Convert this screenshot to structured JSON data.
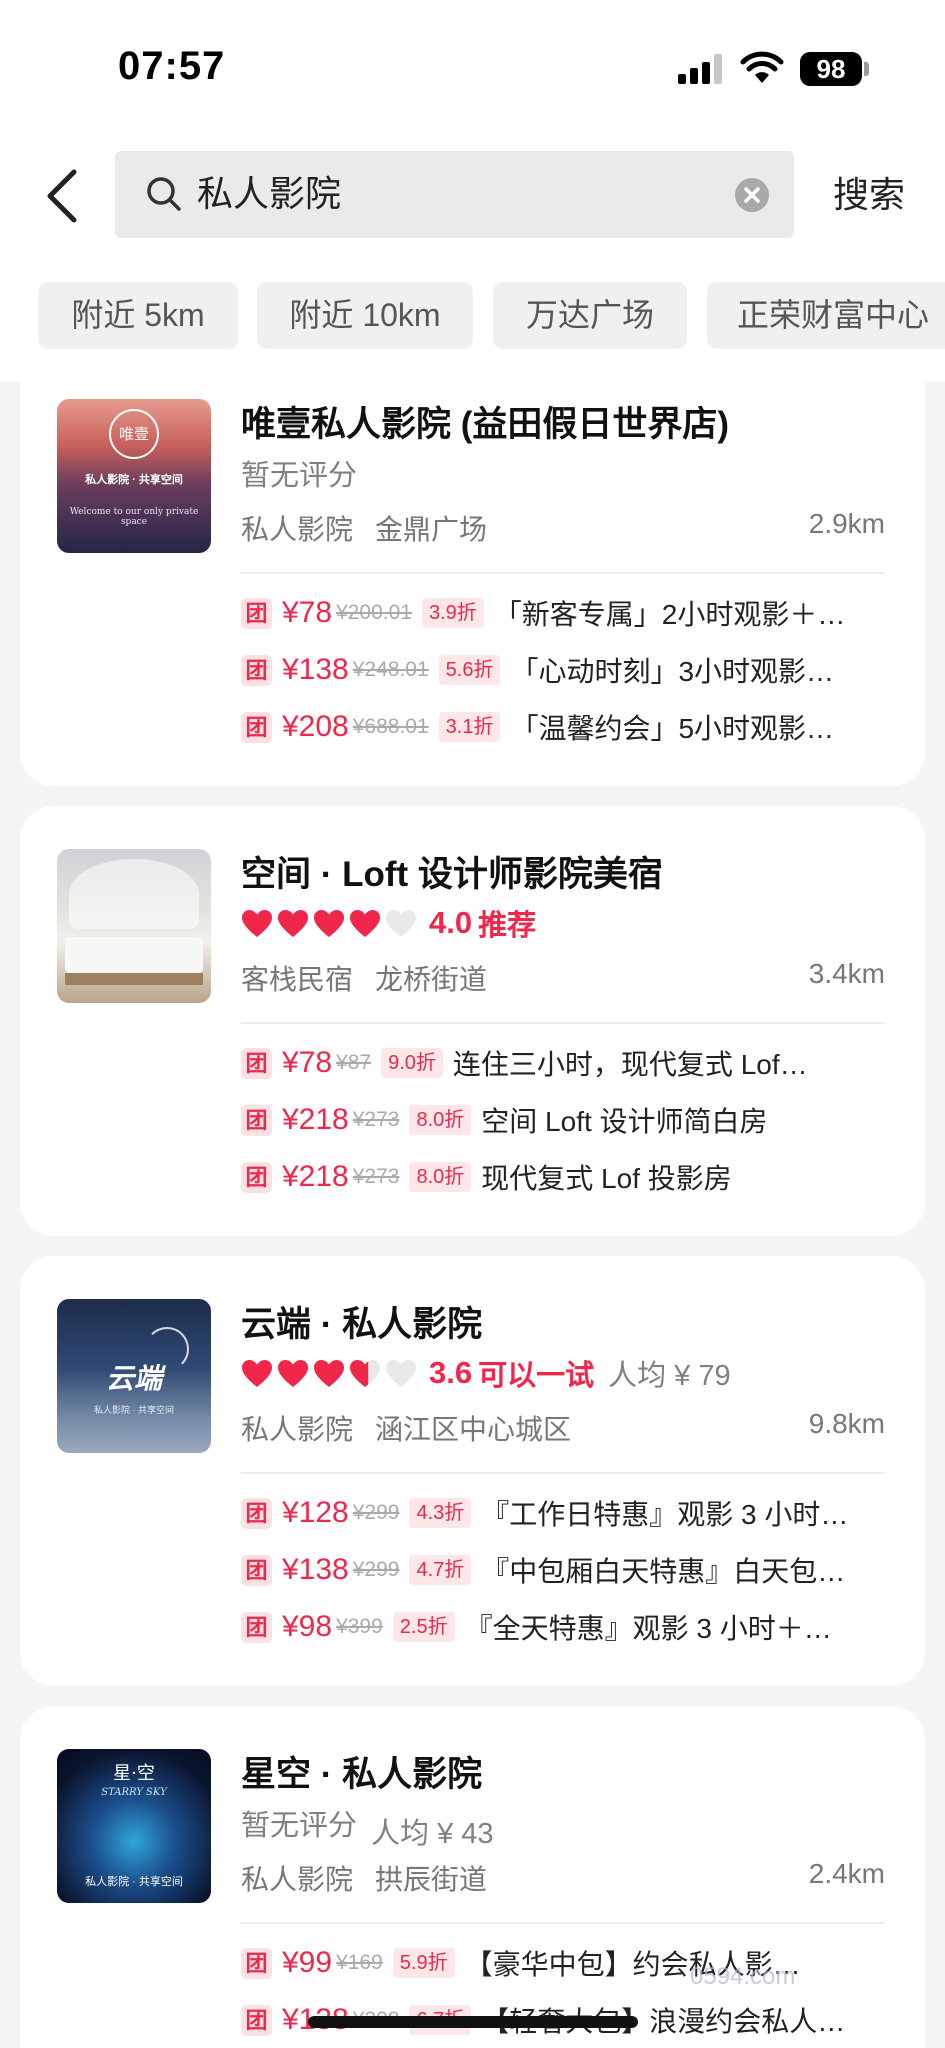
{
  "status": {
    "time": "07:57",
    "battery": "98"
  },
  "search": {
    "query": "私人影院",
    "button": "搜索"
  },
  "chips": [
    "附近 5km",
    "附近 10km",
    "万达广场",
    "正荣财富中心"
  ],
  "listings": [
    {
      "name": "唯壹私人影院 (益田假日世界店)",
      "rating_text": "暂无评分",
      "category": "私人影院",
      "area": "金鼎广场",
      "distance": "2.9km",
      "thumb_text": "私人影院 · 共享空间",
      "thumb_sub": "Welcome to our only private space",
      "thumb_logo": "唯壹",
      "deals": [
        {
          "tag": "团",
          "price": "¥78",
          "original": "¥200.01",
          "discount": "3.9折",
          "title": "「新客专属」2小时观影＋…"
        },
        {
          "tag": "团",
          "price": "¥138",
          "original": "¥248.01",
          "discount": "5.6折",
          "title": "「心动时刻」3小时观影…"
        },
        {
          "tag": "团",
          "price": "¥208",
          "original": "¥688.01",
          "discount": "3.1折",
          "title": "「温馨约会」5小时观影…"
        }
      ]
    },
    {
      "name": "空间 · Loft 设计师影院美宿",
      "score": "4.0",
      "hearts_value": 4.0,
      "verdict": "推荐",
      "category": "客栈民宿",
      "area": "龙桥街道",
      "distance": "3.4km",
      "deals": [
        {
          "tag": "团",
          "price": "¥78",
          "original": "¥87",
          "discount": "9.0折",
          "title": "连住三小时，现代复式 Lof…"
        },
        {
          "tag": "团",
          "price": "¥218",
          "original": "¥273",
          "discount": "8.0折",
          "title": "空间 Loft 设计师简白房"
        },
        {
          "tag": "团",
          "price": "¥218",
          "original": "¥273",
          "discount": "8.0折",
          "title": "现代复式 Lof 投影房"
        }
      ]
    },
    {
      "name": "云端 · 私人影院",
      "score": "3.6",
      "hearts_value": 3.6,
      "verdict": "可以一试",
      "avg_price": "人均 ¥ 79",
      "category": "私人影院",
      "area": "涵江区中心城区",
      "distance": "9.8km",
      "thumb_logo": "云端",
      "thumb_sub": "私人影院 · 共享空间",
      "deals": [
        {
          "tag": "团",
          "price": "¥128",
          "original": "¥299",
          "discount": "4.3折",
          "title": "『工作日特惠』观影 3 小时…"
        },
        {
          "tag": "团",
          "price": "¥138",
          "original": "¥299",
          "discount": "4.7折",
          "title": "『中包厢白天特惠』白天包…"
        },
        {
          "tag": "团",
          "price": "¥98",
          "original": "¥399",
          "discount": "2.5折",
          "title": "『全天特惠』观影 3 小时＋…"
        }
      ]
    },
    {
      "name": "星空 · 私人影院",
      "rating_text": "暂无评分",
      "avg_price": "人均 ¥ 43",
      "category": "私人影院",
      "area": "拱辰街道",
      "distance": "2.4km",
      "thumb_logo": "星·空",
      "thumb_en": "STARRY SKY",
      "thumb_sub": "私人影院 · 共享空间",
      "deals": [
        {
          "tag": "团",
          "price": "¥99",
          "original": "¥169",
          "discount": "5.9折",
          "title": "【豪华中包】约会私人影…"
        },
        {
          "tag": "团",
          "price": "¥138",
          "original": "¥208",
          "discount": "6.7折",
          "title": "【轻奢大包】浪漫约会私人…"
        }
      ]
    }
  ],
  "watermark": "0594.com",
  "colors": {
    "accent": "#f0274b",
    "background": "#f5f5f5"
  }
}
